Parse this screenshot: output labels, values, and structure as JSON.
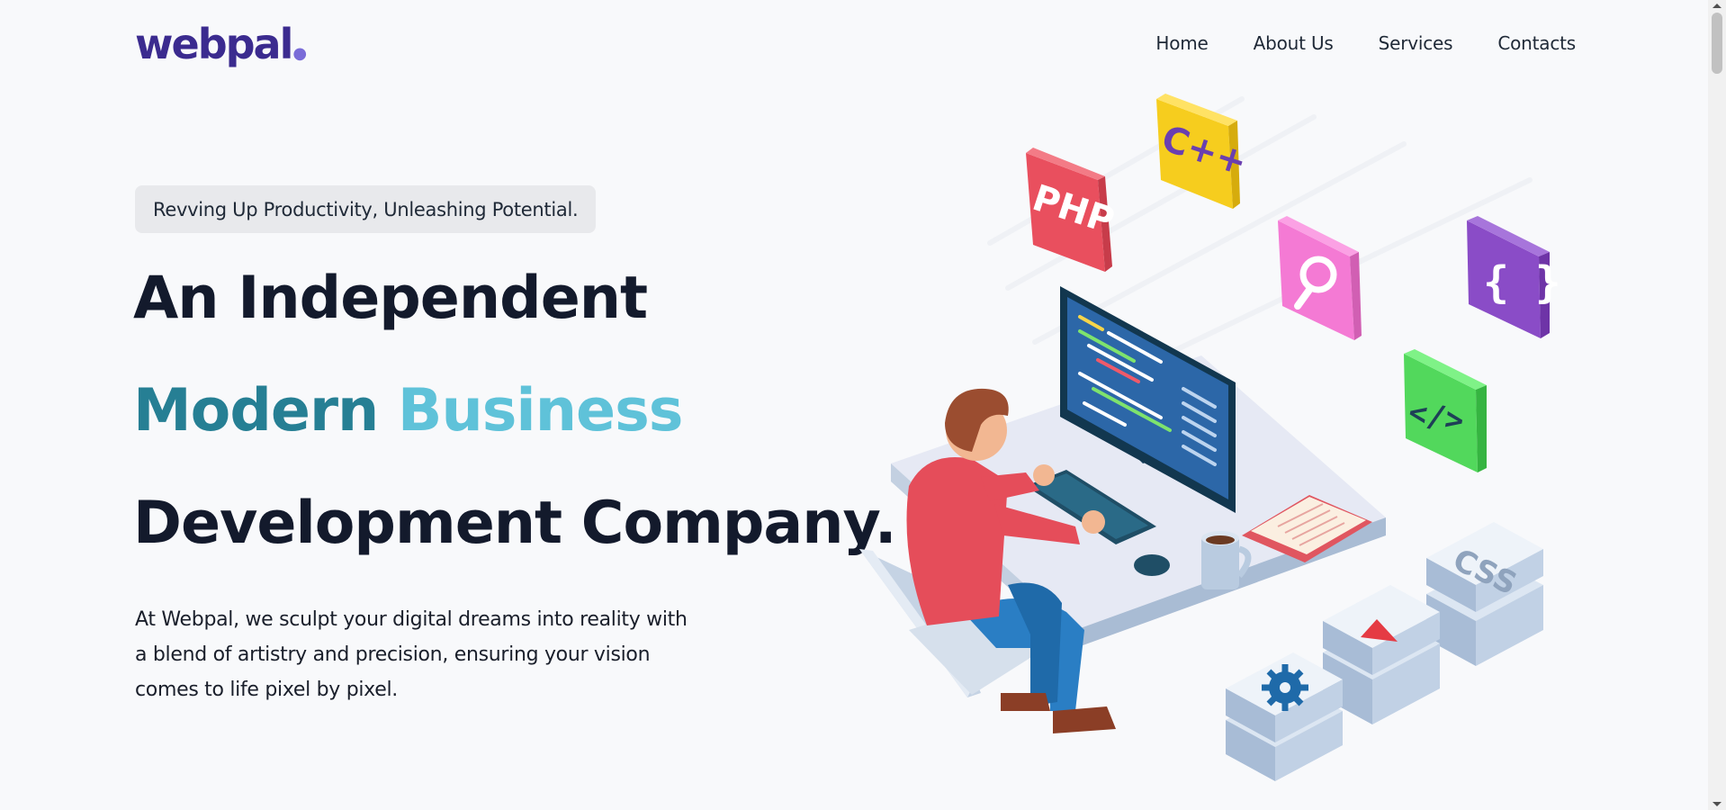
{
  "header": {
    "logo_text": "webpal",
    "nav": [
      {
        "label": "Home"
      },
      {
        "label": "About Us"
      },
      {
        "label": "Services"
      },
      {
        "label": "Contacts"
      }
    ]
  },
  "hero": {
    "tagline": "Revving Up Productivity, Unleashing Potential.",
    "headline_line1": "An Independent",
    "headline_line2_part1": "Modern",
    "headline_line2_part2": "Business",
    "headline_line3": "Development Company.",
    "description": "At Webpal, we sculpt your digital dreams into reality with a blend of artistry and precision, ensuring your vision comes to life pixel by pixel."
  },
  "illustration": {
    "icons": [
      "php-icon",
      "cpp-icon",
      "search-icon",
      "braces-icon",
      "code-tag-icon",
      "css-icon",
      "play-icon",
      "gear-icon"
    ],
    "labels": {
      "php": "PHP",
      "cpp": "C++",
      "braces": "{ }",
      "code": "</>",
      "css": "CSS"
    }
  },
  "colors": {
    "brand": "#3b2b8f",
    "accent_dark": "#267f94",
    "accent_light": "#5fc2d9",
    "text": "#131a2c",
    "pill_bg": "#e8e9ec"
  }
}
